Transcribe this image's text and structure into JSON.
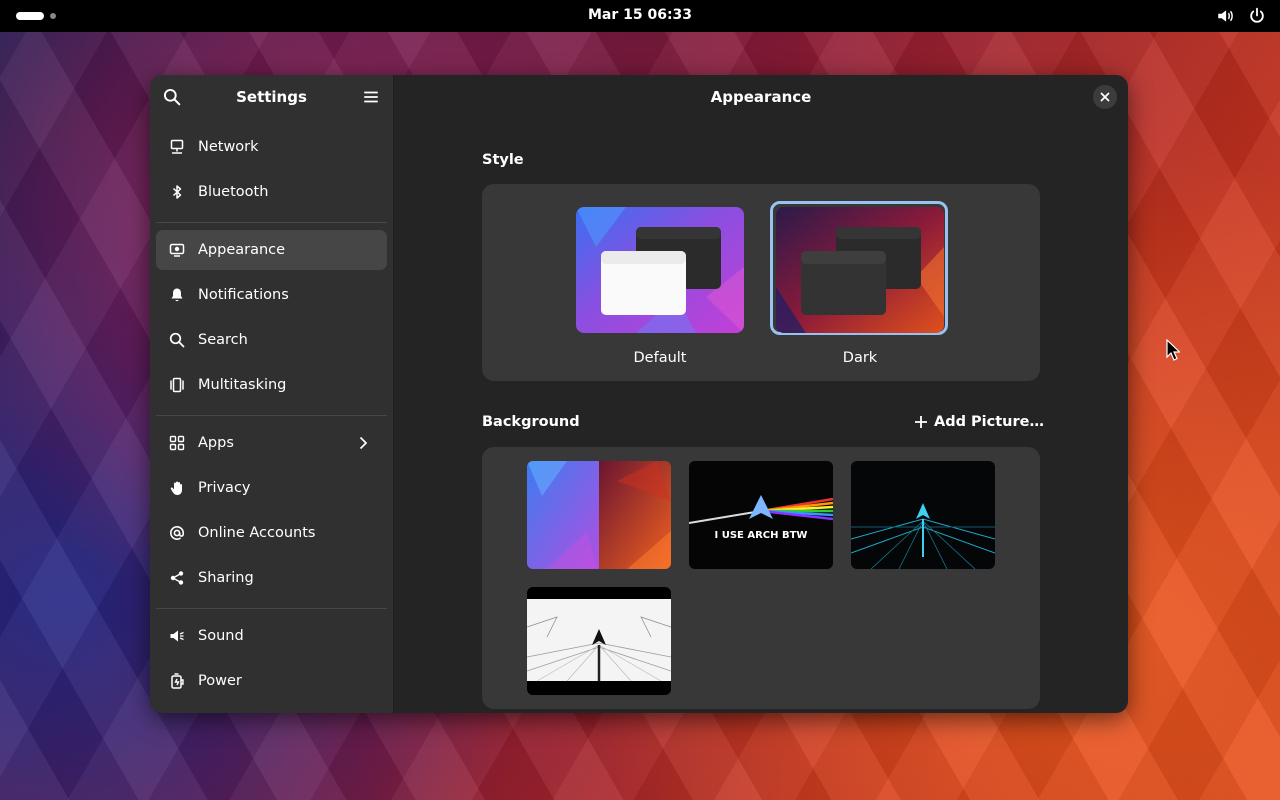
{
  "topbar": {
    "clock": "Mar 15  06:33",
    "icons": [
      "activities-indicator",
      "volume-icon",
      "power-icon"
    ]
  },
  "sidebar": {
    "title": "Settings",
    "search_icon": "search-icon",
    "menu_icon": "hamburger-menu-icon",
    "items": [
      {
        "label": "Network",
        "icon": "network-icon"
      },
      {
        "label": "Bluetooth",
        "icon": "bluetooth-icon"
      },
      {
        "label": "Appearance",
        "icon": "appearance-icon",
        "active": true
      },
      {
        "label": "Notifications",
        "icon": "bell-icon"
      },
      {
        "label": "Search",
        "icon": "search-icon"
      },
      {
        "label": "Multitasking",
        "icon": "multitasking-icon"
      },
      {
        "label": "Apps",
        "icon": "apps-grid-icon",
        "has_submenu": true
      },
      {
        "label": "Privacy",
        "icon": "hand-icon"
      },
      {
        "label": "Online Accounts",
        "icon": "at-sign-icon"
      },
      {
        "label": "Sharing",
        "icon": "share-icon"
      },
      {
        "label": "Sound",
        "icon": "speaker-icon"
      },
      {
        "label": "Power",
        "icon": "power-plug-icon"
      }
    ]
  },
  "content": {
    "title": "Appearance",
    "style": {
      "heading": "Style",
      "options": [
        {
          "label": "Default",
          "selected": false
        },
        {
          "label": "Dark",
          "selected": true
        }
      ]
    },
    "background": {
      "heading": "Background",
      "add_label": "Add Picture…",
      "wallpaper_text": "I USE ARCH BTW"
    }
  },
  "colors": {
    "accent": "#99c1f1",
    "window_bg": "#242424",
    "sidebar_bg": "#303030",
    "card_bg": "#383838",
    "active_item": "#464646"
  }
}
